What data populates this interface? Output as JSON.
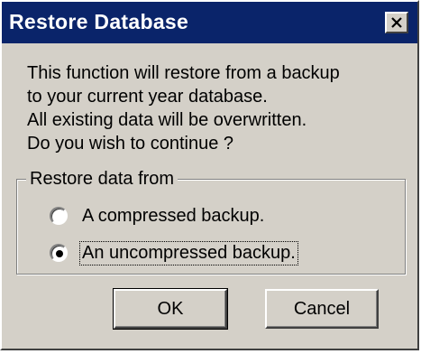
{
  "window": {
    "title": "Restore Database",
    "close_icon": "close-icon"
  },
  "message": {
    "lines": [
      "This function will restore from a backup",
      "to your current year database.",
      "All existing data will be overwritten.",
      "Do you wish to continue ?"
    ]
  },
  "restore_group": {
    "label": "Restore data from",
    "options": [
      {
        "label": "A compressed backup.",
        "selected": false
      },
      {
        "label": "An uncompressed backup.",
        "selected": true
      }
    ]
  },
  "buttons": {
    "ok_label": "OK",
    "cancel_label": "Cancel"
  },
  "colors": {
    "titlebar": "#0a246a",
    "face": "#d4d0c8"
  }
}
